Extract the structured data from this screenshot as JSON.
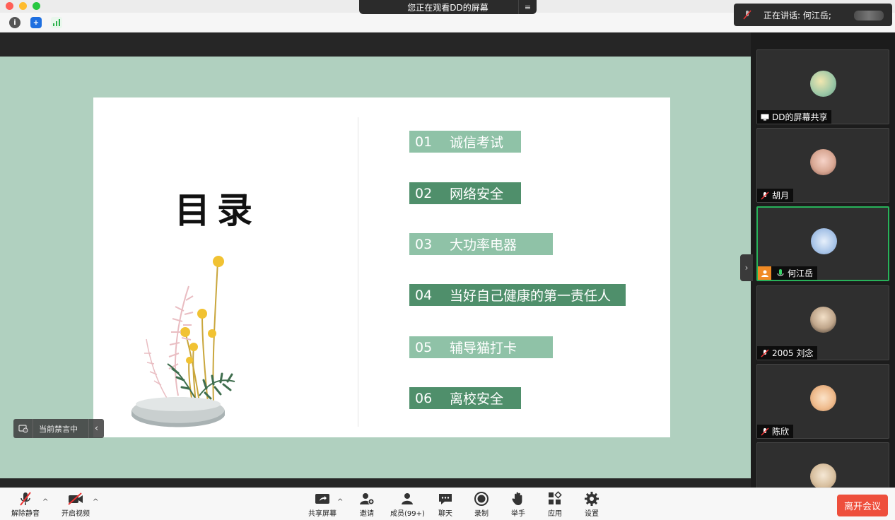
{
  "window": {
    "share_banner": "您正在观看DD的屏幕",
    "speaker_label": "正在讲话: 何江岳;"
  },
  "slide": {
    "title": "目录",
    "items": [
      {
        "num": "01",
        "text": "诚信考试"
      },
      {
        "num": "02",
        "text": "网络安全"
      },
      {
        "num": "03",
        "text": "大功率电器"
      },
      {
        "num": "04",
        "text": "当好自己健康的第一责任人"
      },
      {
        "num": "05",
        "text": "辅导猫打卡"
      },
      {
        "num": "06",
        "text": "离校安全"
      }
    ]
  },
  "mute_badge": "当前禁言中",
  "participants": [
    {
      "name": "DD的屏幕共享",
      "status": "screen-share"
    },
    {
      "name": "胡月",
      "status": "muted"
    },
    {
      "name": "何江岳",
      "status": "speaking"
    },
    {
      "name": "2005 刘念",
      "status": "muted"
    },
    {
      "name": "陈欣",
      "status": "muted"
    },
    {
      "name": "",
      "status": "partial"
    }
  ],
  "controls": {
    "unmute": "解除静音",
    "video": "开启视频",
    "share": "共享屏幕",
    "invite": "邀请",
    "members": "成员(99+)",
    "chat": "聊天",
    "record": "录制",
    "raise_hand": "举手",
    "apps": "应用",
    "settings": "设置",
    "leave": "离开会议"
  },
  "colors": {
    "accent_green": "#28b25a",
    "leave_red": "#ee4f3c",
    "slide_bg": "#b0d0bf",
    "toc_light": "#8fc2a7",
    "toc_dark": "#4f8f6b"
  }
}
